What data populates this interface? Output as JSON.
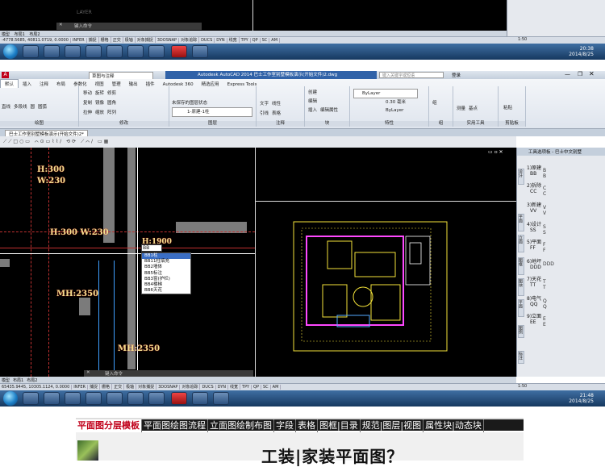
{
  "top_window": {
    "cmd_prompt": "键入命令",
    "coords": "-4778.5685, 40811.0719, 0.0000",
    "layout_tabs": [
      "模型",
      "布局1",
      "布局2"
    ],
    "status_toggles": [
      "INFER",
      "捕捉",
      "栅格",
      "正交",
      "极轴",
      "对象捕捉",
      "3DOSNAP",
      "对象追踪",
      "DUCS",
      "DYN",
      "线宽",
      "TPY",
      "QP",
      "SC",
      "AM"
    ],
    "watermark": "LAYER",
    "scale": "1:50"
  },
  "taskbar_top": {
    "time": "20:38",
    "date": "2014/8/25"
  },
  "app": {
    "title": "Autodesk AutoCAD 2014  巴士工作室别墅模板演示(开始文件)2.dwg",
    "workspace": "草图与注释",
    "search_placeholder": "键入关键字或短语",
    "login": "登录",
    "ribbon_tabs": [
      "默认",
      "插入",
      "注释",
      "布局",
      "参数化",
      "视图",
      "管理",
      "输出",
      "插件",
      "Autodesk 360",
      "精选应用",
      "Express Tools"
    ],
    "panels": {
      "draw": {
        "title": "绘图",
        "tools": [
          "直线",
          "多段线",
          "圆",
          "圆弧"
        ]
      },
      "modify": {
        "title": "修改",
        "tools": [
          "移动",
          "旋转",
          "修剪",
          "复制",
          "镜像",
          "圆角",
          "拉伸",
          "缩放",
          "阵列"
        ]
      },
      "layer": {
        "title": "图层",
        "state": "未保存的图层状态",
        "current": "1-原建-1柱"
      },
      "annotate": {
        "title": "注释",
        "tools": [
          "文字",
          "线性",
          "引线",
          "表格"
        ]
      },
      "block": {
        "title": "块",
        "tools": [
          "插入",
          "创建",
          "编辑",
          "编辑属性"
        ]
      },
      "props": {
        "title": "特性",
        "color": "ByLayer",
        "lineweight": "0.30 毫米",
        "linetype": "ByLayer"
      },
      "groups": {
        "title": "组",
        "tool": "组"
      },
      "utils": {
        "title": "实用工具",
        "tools": [
          "测量",
          "基点"
        ]
      },
      "clip": {
        "title": "剪贴板",
        "tool": "粘贴"
      }
    },
    "doc_tab": "巴士工作室别墅模板演示(开始文件)2*"
  },
  "cad": {
    "dims": [
      "H:300",
      "W:230",
      "H:300 W:230",
      "MH:2350",
      "MH:2350",
      "H:1900"
    ],
    "input": "BB",
    "menu_items": [
      "BB1柱",
      "BB11柱填充",
      "BB2墙体",
      "BB5标注",
      "BB3窗(护栏)",
      "BB4楼梯",
      "BB6天花"
    ],
    "coords": "65435.9445, 10305.1124, 0.0000",
    "cmd_prompt": "键入命令"
  },
  "side": {
    "title": "工具选项板 - 巴士中文别墅",
    "items": [
      {
        "label": "1)原建",
        "code": "BB",
        "letters": "B B"
      },
      {
        "label": "2)拆除",
        "code": "CC",
        "letters": "C C"
      },
      {
        "label": "3)新建",
        "code": "VV",
        "letters": "V V"
      },
      {
        "label": "4)设计",
        "code": "SS",
        "letters": "S S"
      },
      {
        "label": "5)平面",
        "code": "FF",
        "letters": "F F"
      },
      {
        "label": "6)地坪",
        "code": "DDD",
        "letters": "DDD"
      },
      {
        "label": "7)天花",
        "code": "TT",
        "letters": "T T"
      },
      {
        "label": "8)电气",
        "code": "QQ",
        "letters": "Q Q"
      },
      {
        "label": "9)立面",
        "code": "EE",
        "letters": "E E"
      }
    ],
    "vtabs": [
      "设计",
      "平面",
      "立面",
      "图框",
      "图块",
      "平面",
      "图例",
      "标注"
    ]
  },
  "taskbar_bottom": {
    "time": "21:48",
    "date": "2014/8/25"
  },
  "nav": {
    "items": [
      "平面图分层模板",
      "平面图绘图流程",
      "立面图绘制布图",
      "字段",
      "表格",
      "图框|目录",
      "规范|图层|视图",
      "属性块|动态块"
    ]
  },
  "heading": "工装|家装平面图？",
  "colors": {
    "accent": "#c0001a",
    "cad_bg": "#000000",
    "selection": "#3a6ec4"
  }
}
